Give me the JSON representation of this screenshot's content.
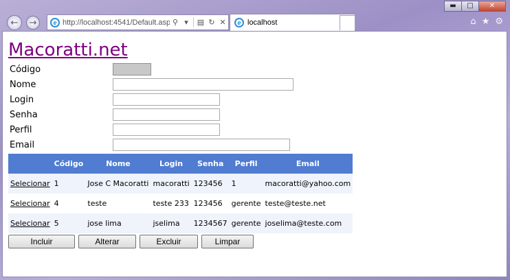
{
  "browser": {
    "address": "http://localhost:4541/Default.aspx",
    "tab_title": "localhost"
  },
  "page": {
    "site_title": "Macoratti.net",
    "form": {
      "codigo_label": "Código",
      "codigo_value": "",
      "nome_label": "Nome",
      "nome_value": "",
      "login_label": "Login",
      "login_value": "",
      "senha_label": "Senha",
      "senha_value": "",
      "perfil_label": "Perfil",
      "perfil_value": "",
      "email_label": "Email",
      "email_value": ""
    },
    "grid": {
      "headers": [
        "",
        "Código",
        "Nome",
        "Login",
        "Senha",
        "Perfil",
        "Email"
      ],
      "select_label": "Selecionar",
      "rows": [
        {
          "codigo": "1",
          "nome": "Jose C Macoratti",
          "login": "macoratti",
          "senha": "123456",
          "perfil": "1",
          "email": "macoratti@yahoo.com"
        },
        {
          "codigo": "4",
          "nome": "teste",
          "login": "teste 233",
          "senha": "123456",
          "perfil": "gerente",
          "email": "teste@teste.net"
        },
        {
          "codigo": "5",
          "nome": "jose lima",
          "login": "jselima",
          "senha": "1234567",
          "perfil": "gerente",
          "email": "joselima@teste.com"
        }
      ]
    },
    "buttons": {
      "incluir": "Incluir",
      "alterar": "Alterar",
      "excluir": "Excluir",
      "limpar": "Limpar"
    }
  },
  "colors": {
    "grid_header": "#507cd1",
    "grid_alt_row": "#eff3fb",
    "link_visited": "#800080"
  }
}
